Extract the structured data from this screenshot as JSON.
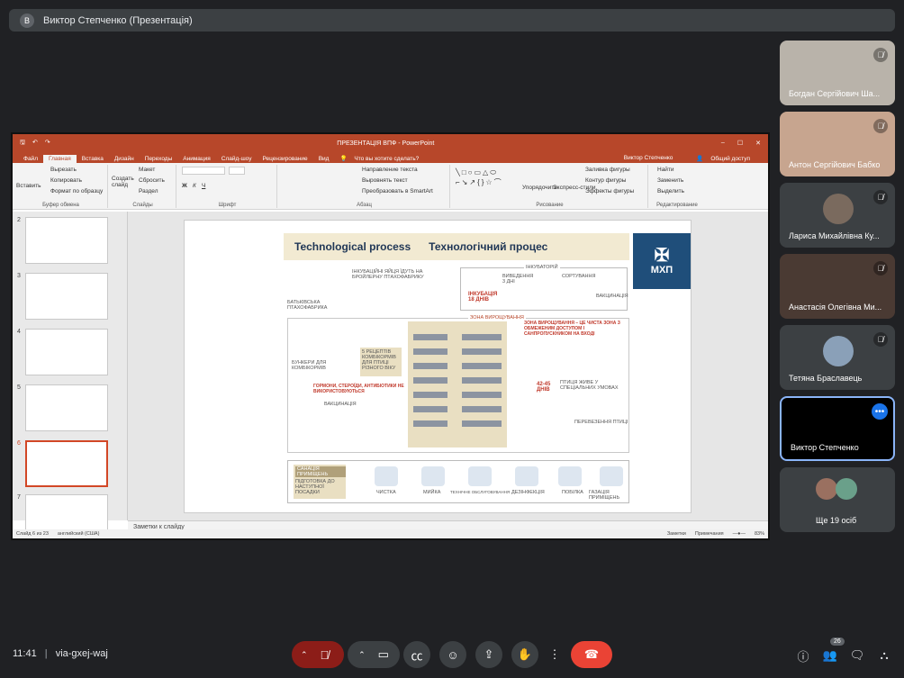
{
  "meeting": {
    "presenter_title": "Виктор Степченко (Презентація)",
    "presenter_initial": "В",
    "time": "11:41",
    "separator": "|",
    "code": "via-gxej-waj",
    "participants_badge": "26"
  },
  "ppt": {
    "window_title": "ПРЕЗЕНТАЦІЯ ВПФ - PowerPoint",
    "user": "Виктор Степченко",
    "share": "Общий доступ",
    "tabs": [
      "Файл",
      "Главная",
      "Вставка",
      "Дизайн",
      "Переходы",
      "Анимация",
      "Слайд-шоу",
      "Рецензирование",
      "Вид"
    ],
    "tell_me": "Что вы хотите сделать?",
    "ribbon": {
      "paste": "Вставить",
      "cut": "Вырезать",
      "copy": "Копировать",
      "format": "Формат по образцу",
      "clipboard": "Буфер обмена",
      "new_slide": "Создать слайд",
      "layout": "Макет",
      "reset": "Сбросить",
      "section": "Раздел",
      "slides": "Слайды",
      "font": "Шрифт",
      "paragraph": "Абзац",
      "text_dir": "Направление текста",
      "align_text": "Выровнять текст",
      "smartart": "Преобразовать в SmartArt",
      "arrange": "Упорядочить",
      "quick_styles": "Экспресс-стили",
      "fill": "Заливка фигуры",
      "outline": "Контур фигуры",
      "effects": "Эффекты фигуры",
      "drawing": "Рисование",
      "find": "Найти",
      "replace": "Заменить",
      "select": "Выделить",
      "editing": "Редактирование"
    },
    "slide_numbers": [
      "2",
      "3",
      "4",
      "5",
      "6",
      "7"
    ],
    "notes_placeholder": "Заметки к слайду",
    "status": {
      "slide": "Слайд 6 из 23",
      "lang": "английский (США)",
      "notes": "Заметки",
      "comments": "Примечания",
      "zoom": "83%"
    }
  },
  "slide": {
    "title_en": "Technological process",
    "title_ua": "Технологічний процес",
    "logo": "МХП",
    "labels": {
      "parents": "БАТЬКІВСЬКА ПТАХОФАБРИКА",
      "hatch": "ІНКУБАТОРІЙ",
      "eggs": "ІНКУБАЦІЙНІ ЯЙЦЯ ЇДУТЬ НА БРОЙЛЕРНУ ПТАХОФАБРИКУ",
      "incubation": "ІНКУБАЦІЯ 18 ДНІВ",
      "hatching": "ВИВЕДЕННЯ 3 ДНІ",
      "sorting": "СОРТУВАННЯ",
      "vaccination_hatch": "ВАКЦИНАЦІЯ",
      "grow_zone": "ЗОНА ВИРОЩУВАННЯ",
      "bunkers": "БУНКЕРИ ДЛЯ КОМБІКОРМІВ",
      "recipes": "5 РЕЦЕПТІВ КОМБІКОРМІВ ДЛЯ ПТИЦІ РІЗНОГО ВІКУ",
      "no_hormones": "ГОРМОНИ, СТЕРОЇДИ, АНТИБІОТИКИ НЕ ВИКОРИСТОВУЮТЬСЯ",
      "vaccination": "ВАКЦИНАЦІЯ",
      "clean_zone": "ЗОНА ВИРОЩУВАННЯ – ЦЕ ЧИСТА ЗОНА З ОБМЕЖЕНИМ ДОСТУПОМ І САНПРОПУСКНИКОМ НА ВХОДІ",
      "days_42": "42-45 ДНІВ",
      "live": "ПТИЦЯ ЖИВЕ У СПЕЦІАЛЬНИХ УМОВАХ",
      "transport": "ПЕРЕВЕЗЕННЯ ПТИЦІ",
      "sanitation": "САНАЦІЯ ПРИМІЩЕНЬ",
      "prep": "ПІДГОТОВКА ДО НАСТУПНОЇ ПОСАДКИ",
      "steps": [
        "ЧИСТКА",
        "МИЙКА",
        "ТЕХНІЧНЕ ОБСЛУГОВУВАННЯ",
        "ДЕЗІНФЕКЦІЯ",
        "ПОБІЛКА",
        "ГАЗАЦІЯ ПРИМІЩЕНЬ"
      ]
    }
  },
  "participants": [
    {
      "name": "Богдан Сергійович Ша...",
      "muted": true
    },
    {
      "name": "Антон Сергійович Бабко",
      "muted": true
    },
    {
      "name": "Лариса Михайлівна Ку...",
      "muted": true
    },
    {
      "name": "Анастасія Олегівна Ми...",
      "muted": true
    },
    {
      "name": "Тетяна Браславець",
      "muted": true
    },
    {
      "name": "Виктор Степченко",
      "muted": false
    },
    {
      "name": "Ще 19 осіб",
      "muted": false
    }
  ],
  "colors": {
    "ppt_red": "#b7472a",
    "meet_bg": "#202124",
    "hangup": "#ea4335",
    "active_border": "#8ab4f8"
  }
}
